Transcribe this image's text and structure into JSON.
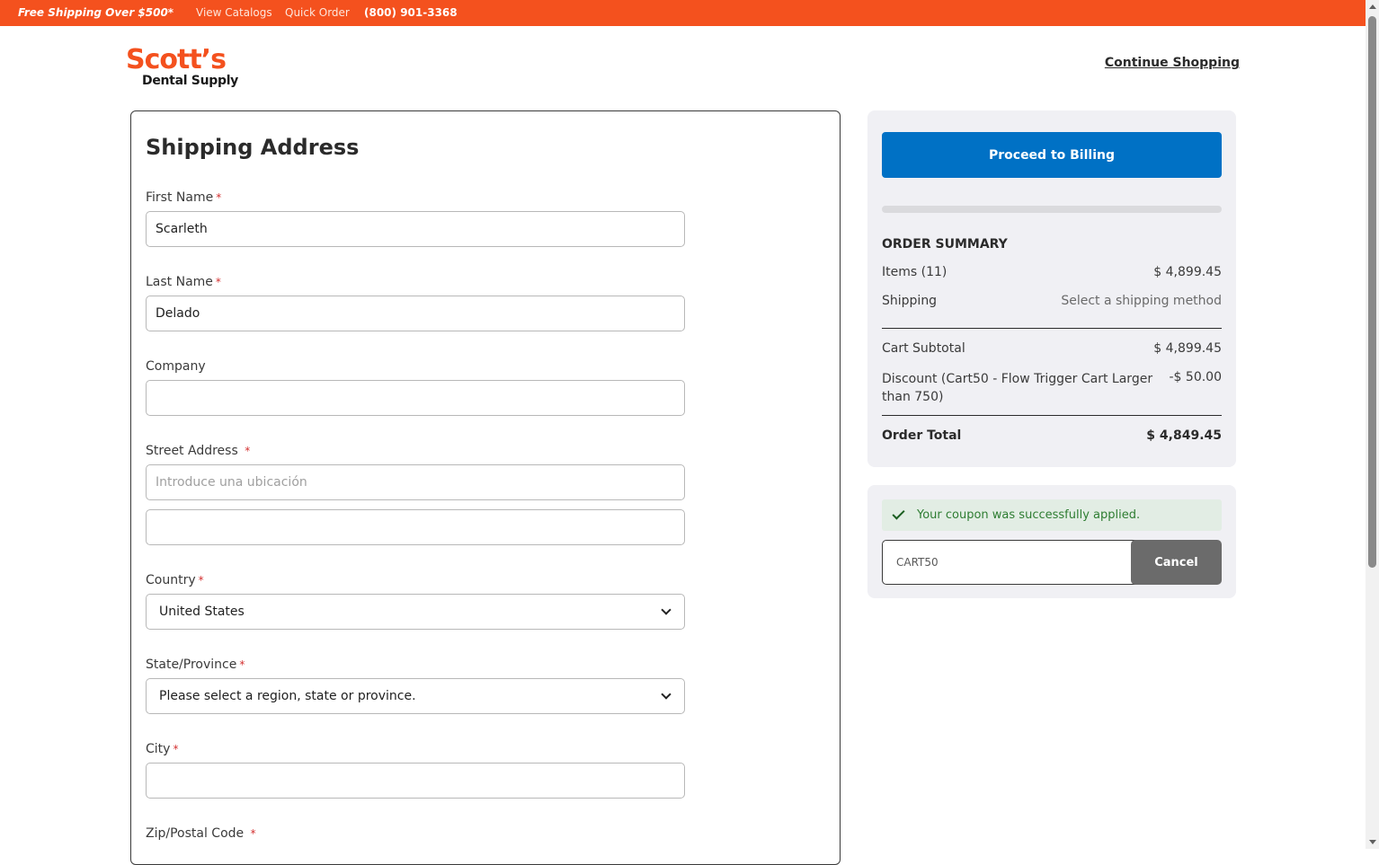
{
  "topbar": {
    "promo": "Free Shipping Over $500*",
    "view_catalogs": "View Catalogs",
    "quick_order": "Quick Order",
    "phone": "(800) 901-3368"
  },
  "brand": {
    "line1": "Scott’s",
    "line2": "Dental Supply"
  },
  "header": {
    "continue_shopping": "Continue Shopping"
  },
  "shipping": {
    "title": "Shipping Address",
    "required_mark": "*",
    "first_name_label": "First Name",
    "first_name_value": "Scarleth",
    "last_name_label": "Last Name",
    "last_name_value": "Delado",
    "company_label": "Company",
    "company_value": "",
    "street_label": "Street Address",
    "street_placeholder": "Introduce una ubicación",
    "street2_value": "",
    "country_label": "Country",
    "country_value": "United States",
    "state_label": "State/Province",
    "state_value": "Please select a region, state or province.",
    "city_label": "City",
    "city_value": "",
    "zip_label": "Zip/Postal Code"
  },
  "summary": {
    "proceed_label": "Proceed to Billing",
    "progress": 0,
    "title": "ORDER SUMMARY",
    "items_label": "Items (11)",
    "items_value": "$ 4,899.45",
    "shipping_label": "Shipping",
    "shipping_value": "Select a shipping method",
    "subtotal_label": "Cart Subtotal",
    "subtotal_value": "$ 4,899.45",
    "discount_label": "Discount (Cart50 - Flow Trigger Cart Larger than 750)",
    "discount_value": "-$ 50.00",
    "total_label": "Order Total",
    "total_value": "$ 4,849.45"
  },
  "coupon": {
    "message": "Your coupon was successfully applied.",
    "code": "CART50",
    "cancel_label": "Cancel"
  },
  "colors": {
    "brand_orange": "#f4511e",
    "primary_blue": "#0071c5",
    "success_green": "#2e7d32"
  }
}
